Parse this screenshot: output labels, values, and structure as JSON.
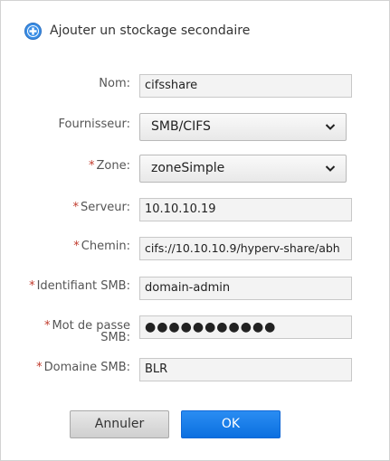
{
  "dialog": {
    "title": "Ajouter un stockage secondaire",
    "title_icon": "add-circle-icon",
    "required_marker": "*",
    "fields": {
      "name": {
        "label": "Nom:",
        "value": "cifsshare"
      },
      "provider": {
        "label": "Fournisseur:",
        "value": "SMB/CIFS"
      },
      "zone": {
        "label": "Zone:",
        "value": "zoneSimple"
      },
      "server": {
        "label": "Serveur:",
        "value": "10.10.10.19"
      },
      "path": {
        "label": "Chemin:",
        "value": "cifs://10.10.10.9/hyperv-share/abh"
      },
      "smb_user": {
        "label": "Identifiant SMB:",
        "value": "domain-admin"
      },
      "smb_password": {
        "label_line1": "Mot de passe",
        "label_line2": "SMB:",
        "value": "●●●●●●●●●●●"
      },
      "smb_domain": {
        "label": "Domaine SMB:",
        "value": "BLR"
      }
    },
    "buttons": {
      "cancel": "Annuler",
      "ok": "OK"
    }
  },
  "colors": {
    "accent": "#0b6fe0",
    "required": "#c0392b",
    "icon_blue": "#3a8ee6"
  }
}
